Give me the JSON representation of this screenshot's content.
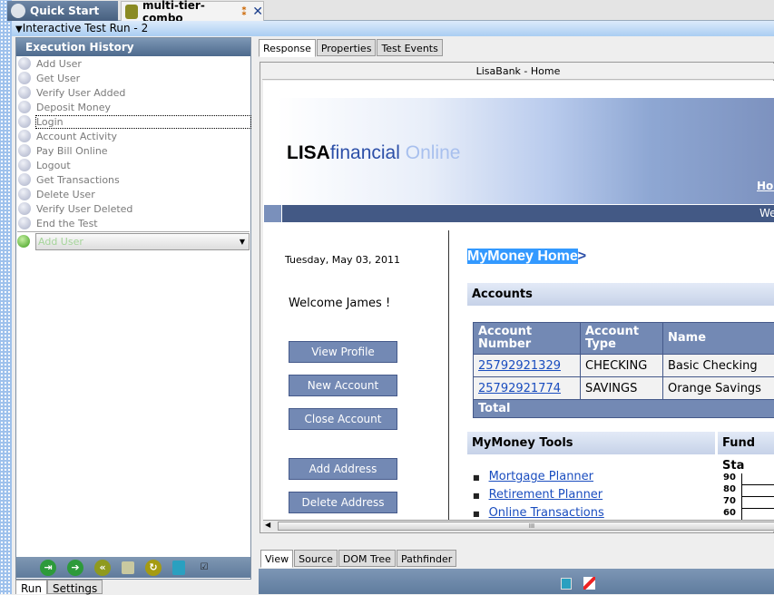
{
  "tabs": {
    "quick_start": "Quick Start",
    "editor": "multi-tier-combo"
  },
  "run_title": "Interactive Test Run - 2",
  "execution_history": {
    "title": "Execution History",
    "steps": [
      "Add User",
      "Get User",
      "Verify User Added",
      "Deposit Money",
      "Login",
      "Account Activity",
      "Pay Bill Online",
      "Logout",
      "Get Transactions",
      "Delete User",
      "Verify User Deleted",
      "End the Test"
    ],
    "selected_step": "Login",
    "next_step": "Add User"
  },
  "left_bottom_tabs": [
    "Run",
    "Settings"
  ],
  "response_tabs": [
    "Response",
    "Properties",
    "Test Events"
  ],
  "browser_title": "LisaBank - Home",
  "page": {
    "logo_bold": "LISA",
    "logo_mid": "financial",
    "logo_light": " Online",
    "home_link": "Hor",
    "nav_text": "We",
    "date": "Tuesday, May 03, 2011",
    "welcome": "Welcome James !",
    "buttons": [
      "View Profile",
      "New Account",
      "Close Account",
      "Add Address",
      "Delete Address"
    ],
    "heading": "MyMoney Home",
    "heading_arrow": ">",
    "accounts_title": "Accounts",
    "table": {
      "headers": [
        "Account Number",
        "Account Type",
        "Name"
      ],
      "rows": [
        [
          "25792921329",
          "CHECKING",
          "Basic Checking"
        ],
        [
          "25792921774",
          "SAVINGS",
          "Orange Savings"
        ]
      ],
      "total": "Total"
    },
    "tools_title": "MyMoney Tools",
    "fund_title": "Fund Sta",
    "tools_links": [
      "Mortgage Planner",
      "Retirement Planner",
      "Online Transactions"
    ],
    "chart_ticks": [
      "90",
      "80",
      "70",
      "60"
    ]
  },
  "scroll_grip": "III",
  "view_tabs": [
    "View",
    "Source",
    "DOM Tree",
    "Pathfinder"
  ]
}
